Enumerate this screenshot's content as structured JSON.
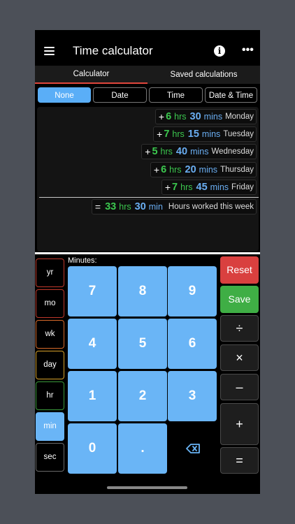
{
  "header": {
    "title": "Time calculator",
    "info_icon": "info-icon",
    "more_icon": "more-icon",
    "more_glyph": "•••"
  },
  "tabs": [
    {
      "label": "Calculator"
    },
    {
      "label": "Saved calculations"
    }
  ],
  "mode_segments": [
    {
      "label": "None"
    },
    {
      "label": "Date"
    },
    {
      "label": "Time"
    },
    {
      "label": "Date & Time"
    }
  ],
  "entries": [
    {
      "sign": "+",
      "hours": "6",
      "hrs_unit": "hrs",
      "minutes": "30",
      "mins_unit": "mins",
      "label": "Monday"
    },
    {
      "sign": "+",
      "hours": "7",
      "hrs_unit": "hrs",
      "minutes": "15",
      "mins_unit": "mins",
      "label": "Tuesday"
    },
    {
      "sign": "+",
      "hours": "5",
      "hrs_unit": "hrs",
      "minutes": "40",
      "mins_unit": "mins",
      "label": "Wednesday"
    },
    {
      "sign": "+",
      "hours": "6",
      "hrs_unit": "hrs",
      "minutes": "20",
      "mins_unit": "mins",
      "label": "Thursday"
    },
    {
      "sign": "+",
      "hours": "7",
      "hrs_unit": "hrs",
      "minutes": "45",
      "mins_unit": "mins",
      "label": "Friday"
    }
  ],
  "total": {
    "sign": "=",
    "hours": "33",
    "hrs_unit": "hrs",
    "minutes": "30",
    "mins_unit": "min",
    "label": "Hours worked this week"
  },
  "keypad": {
    "minutes_label": "Minutes:",
    "units": [
      "yr",
      "mo",
      "wk",
      "day",
      "hr",
      "min",
      "sec"
    ],
    "digits": [
      "7",
      "8",
      "9",
      "4",
      "5",
      "6",
      "1",
      "2",
      "3",
      "0",
      "."
    ],
    "reset": "Reset",
    "save": "Save",
    "ops": [
      "÷",
      "×",
      "–",
      "+",
      "="
    ]
  },
  "colors": {
    "accent_blue": "#6ab5f6",
    "hours_green": "#3cc84f",
    "reset_red": "#d9403f",
    "save_green": "#3fae45",
    "unit_borders": [
      "#c0392b",
      "#c0392b",
      "#d86a2a",
      "#d8a22a",
      "#3a9a3a",
      "#6ab5f6",
      "#6a6a6a"
    ]
  }
}
